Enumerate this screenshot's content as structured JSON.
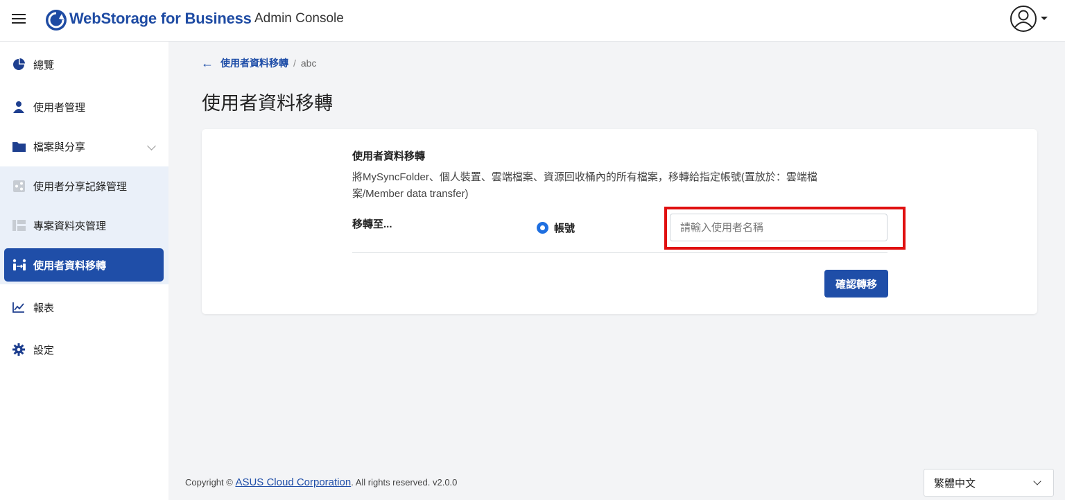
{
  "header": {
    "brand": "WebStorage for Business",
    "subtitle": "Admin Console"
  },
  "sidebar": {
    "items": [
      {
        "label": "總覽",
        "icon": "pie-chart-icon"
      },
      {
        "label": "使用者管理",
        "icon": "user-icon"
      },
      {
        "label": "檔案與分享",
        "icon": "folder-icon"
      },
      {
        "label": "使用者分享記錄管理",
        "icon": "share-record-icon"
      },
      {
        "label": "專案資料夾管理",
        "icon": "project-folder-icon"
      },
      {
        "label": "使用者資料移轉",
        "icon": "transfer-icon"
      },
      {
        "label": "報表",
        "icon": "line-chart-icon"
      },
      {
        "label": "設定",
        "icon": "gear-icon"
      }
    ]
  },
  "breadcrumb": {
    "back_label": "使用者資料移轉",
    "separator": "/",
    "current": "abc"
  },
  "main": {
    "page_title": "使用者資料移轉",
    "section_title": "使用者資料移轉",
    "section_desc": "將MySyncFolder、個人裝置、雲端檔案、資源回收桶內的所有檔案，移轉給指定帳號(置放於：雲端檔案/Member data transfer)",
    "transfer_to_label": "移轉至...",
    "radio_label": "帳號",
    "input_placeholder": "請輸入使用者名稱",
    "confirm_label": "確認轉移"
  },
  "footer": {
    "prefix": "Copyright © ",
    "company": "ASUS Cloud Corporation",
    "suffix": ". All rights reserved. v2.0.0"
  },
  "language": {
    "selected": "繁體中文"
  },
  "colors": {
    "brand": "#1e4ba3",
    "active_nav": "#1f4ea8",
    "highlight": "#e01010"
  }
}
